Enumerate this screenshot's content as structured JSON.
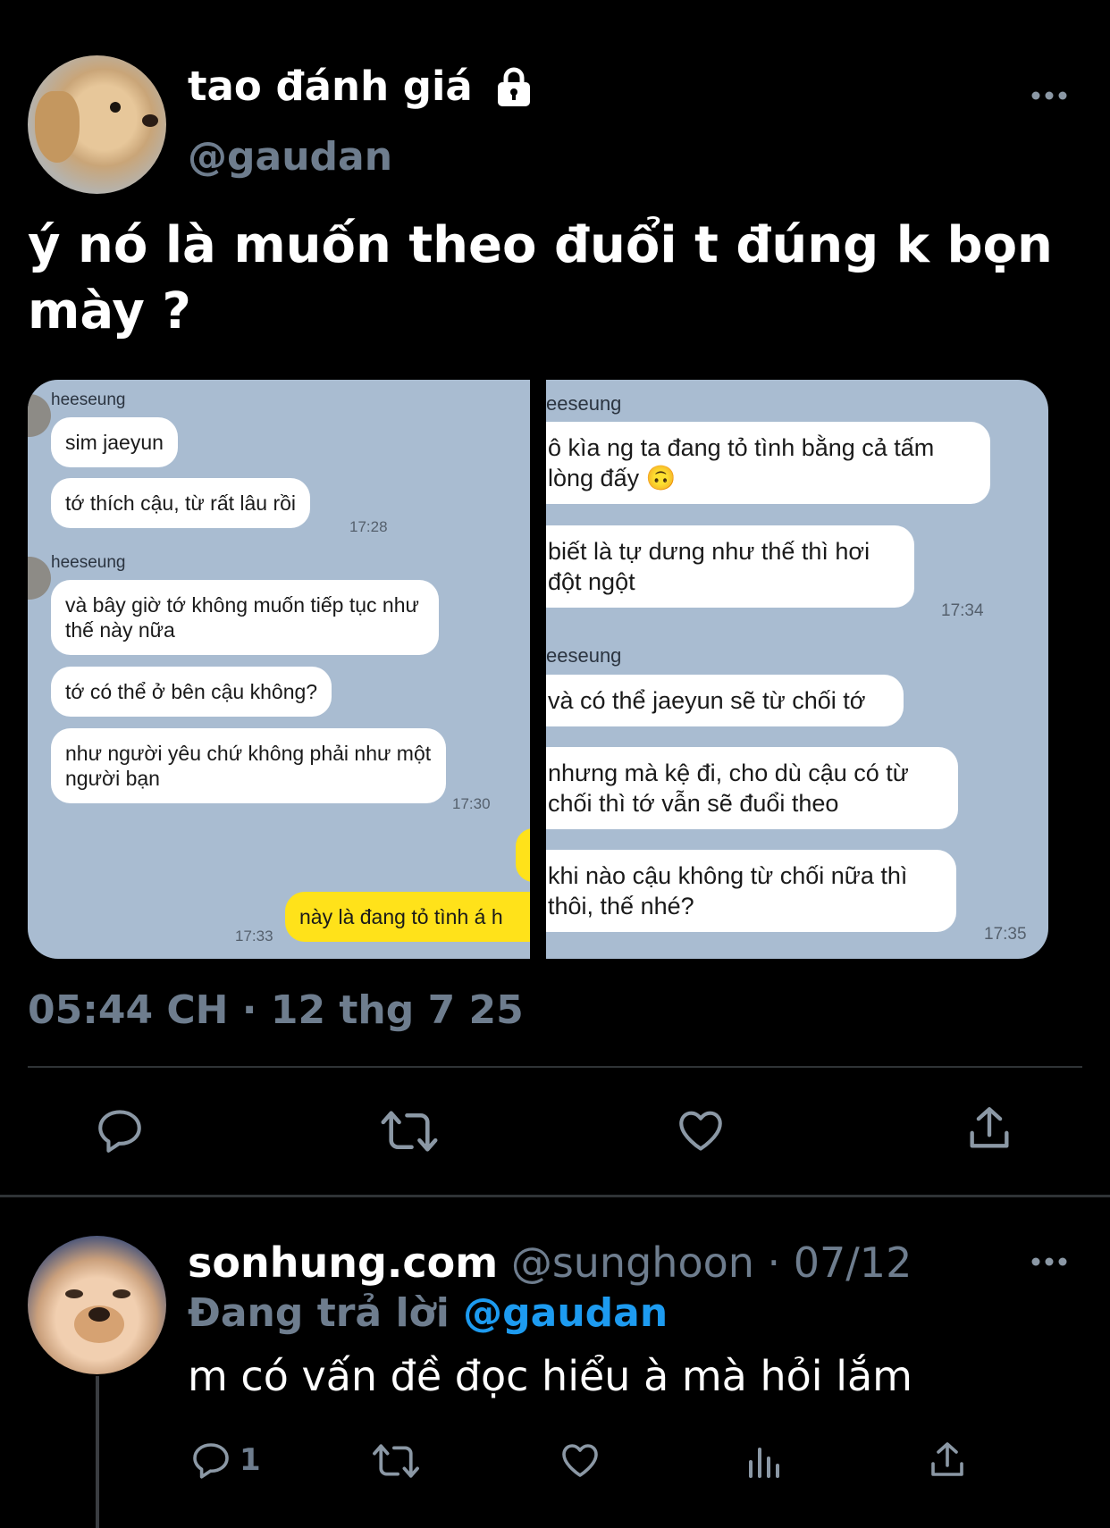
{
  "author": {
    "display_name": "tao đánh giá",
    "handle": "@gaudan"
  },
  "tweet": {
    "text": "ý nó là muốn theo đuổi t đúng k bọn mày ?",
    "timestamp": "05:44 CH · 12 thg 7 25"
  },
  "chat_left": {
    "sender1": "heeseung",
    "msg1": "sim jaeyun",
    "msg2": "tớ thích cậu, từ rất lâu rồi",
    "time1": "17:28",
    "sender2": "heeseung",
    "msg3": "và bây giờ tớ không muốn tiếp tục như thế này nữa",
    "msg4": "tớ có thể ở bên cậu không?",
    "msg5": "như người yêu chứ không phải như một người bạn",
    "time2": "17:30",
    "yellow_msg": "này là đang tỏ tình á h",
    "time3": "17:33"
  },
  "chat_right": {
    "sender1": "eeseung",
    "msg1": "ô kìa ng ta đang tỏ tình bằng cả tấm lòng đấy 🙃",
    "msg2": "biết là tự dưng như thế thì hơi đột ngột",
    "time1": "17:34",
    "sender2": "eeseung",
    "msg3": "và có thể jaeyun sẽ từ chối tớ",
    "msg4": "nhưng mà kệ đi, cho dù cậu có từ chối thì tớ vẫn sẽ đuổi theo",
    "msg5": "khi nào cậu không từ chối nữa thì thôi, thế nhé?",
    "time2": "17:35"
  },
  "actions": {
    "icons": [
      "reply-icon",
      "retweet-icon",
      "like-icon",
      "share-icon"
    ]
  },
  "reply": {
    "name": "sonhung.com",
    "handle": "@sunghoon",
    "separator": "·",
    "date": "07/12",
    "replying_prefix": "Đang trả lời",
    "replying_handle": "@gaudan",
    "text": "m có vấn đề đọc hiểu à mà hỏi lắm",
    "reply_count": "1"
  },
  "colors": {
    "background": "#000000",
    "muted": "#6e7d8e",
    "link": "#1d9bf0",
    "chat_bg": "#a9bcd1",
    "bubble_yellow": "#ffe21a"
  }
}
